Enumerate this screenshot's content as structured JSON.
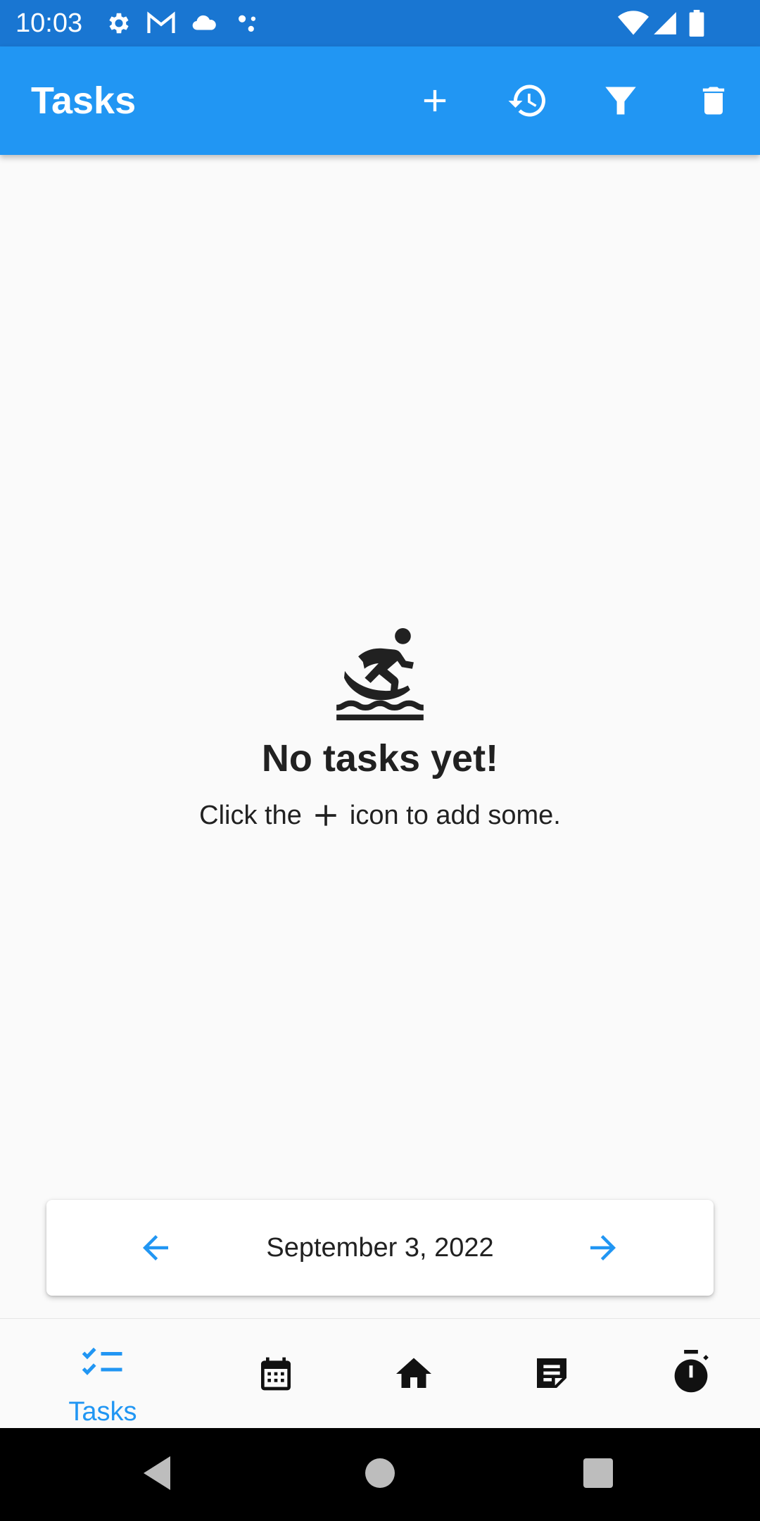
{
  "status_bar": {
    "time": "10:03",
    "left_icons": [
      "settings-icon",
      "gmail-icon",
      "cloud-icon",
      "assistant-dots-icon"
    ],
    "right_icons": [
      "wifi-icon",
      "signal-icon",
      "battery-icon"
    ],
    "color": "#1976d2"
  },
  "app_bar": {
    "title": "Tasks",
    "color": "#2196f3",
    "actions": [
      "add-icon",
      "history-icon",
      "filter-icon",
      "delete-icon"
    ]
  },
  "empty_state": {
    "icon": "surfing-icon",
    "title": "No tasks yet!",
    "hint_before": "Click the",
    "hint_icon": "add-icon",
    "hint_after": "icon to add some."
  },
  "date_nav": {
    "date": "September 3, 2022",
    "prev_icon": "arrow-back-icon",
    "next_icon": "arrow-forward-icon",
    "accent": "#2196f3"
  },
  "bottom_nav": {
    "items": [
      {
        "label": "Tasks",
        "icon": "checklist-icon",
        "selected": true
      },
      {
        "label": "",
        "icon": "calendar-icon",
        "selected": false
      },
      {
        "label": "",
        "icon": "home-icon",
        "selected": false
      },
      {
        "label": "",
        "icon": "note-icon",
        "selected": false
      },
      {
        "label": "",
        "icon": "timer-icon",
        "selected": false
      }
    ],
    "selected_color": "#2196f3"
  },
  "system_nav": {
    "buttons": [
      "back-icon",
      "home-circle-icon",
      "recents-icon"
    ]
  }
}
